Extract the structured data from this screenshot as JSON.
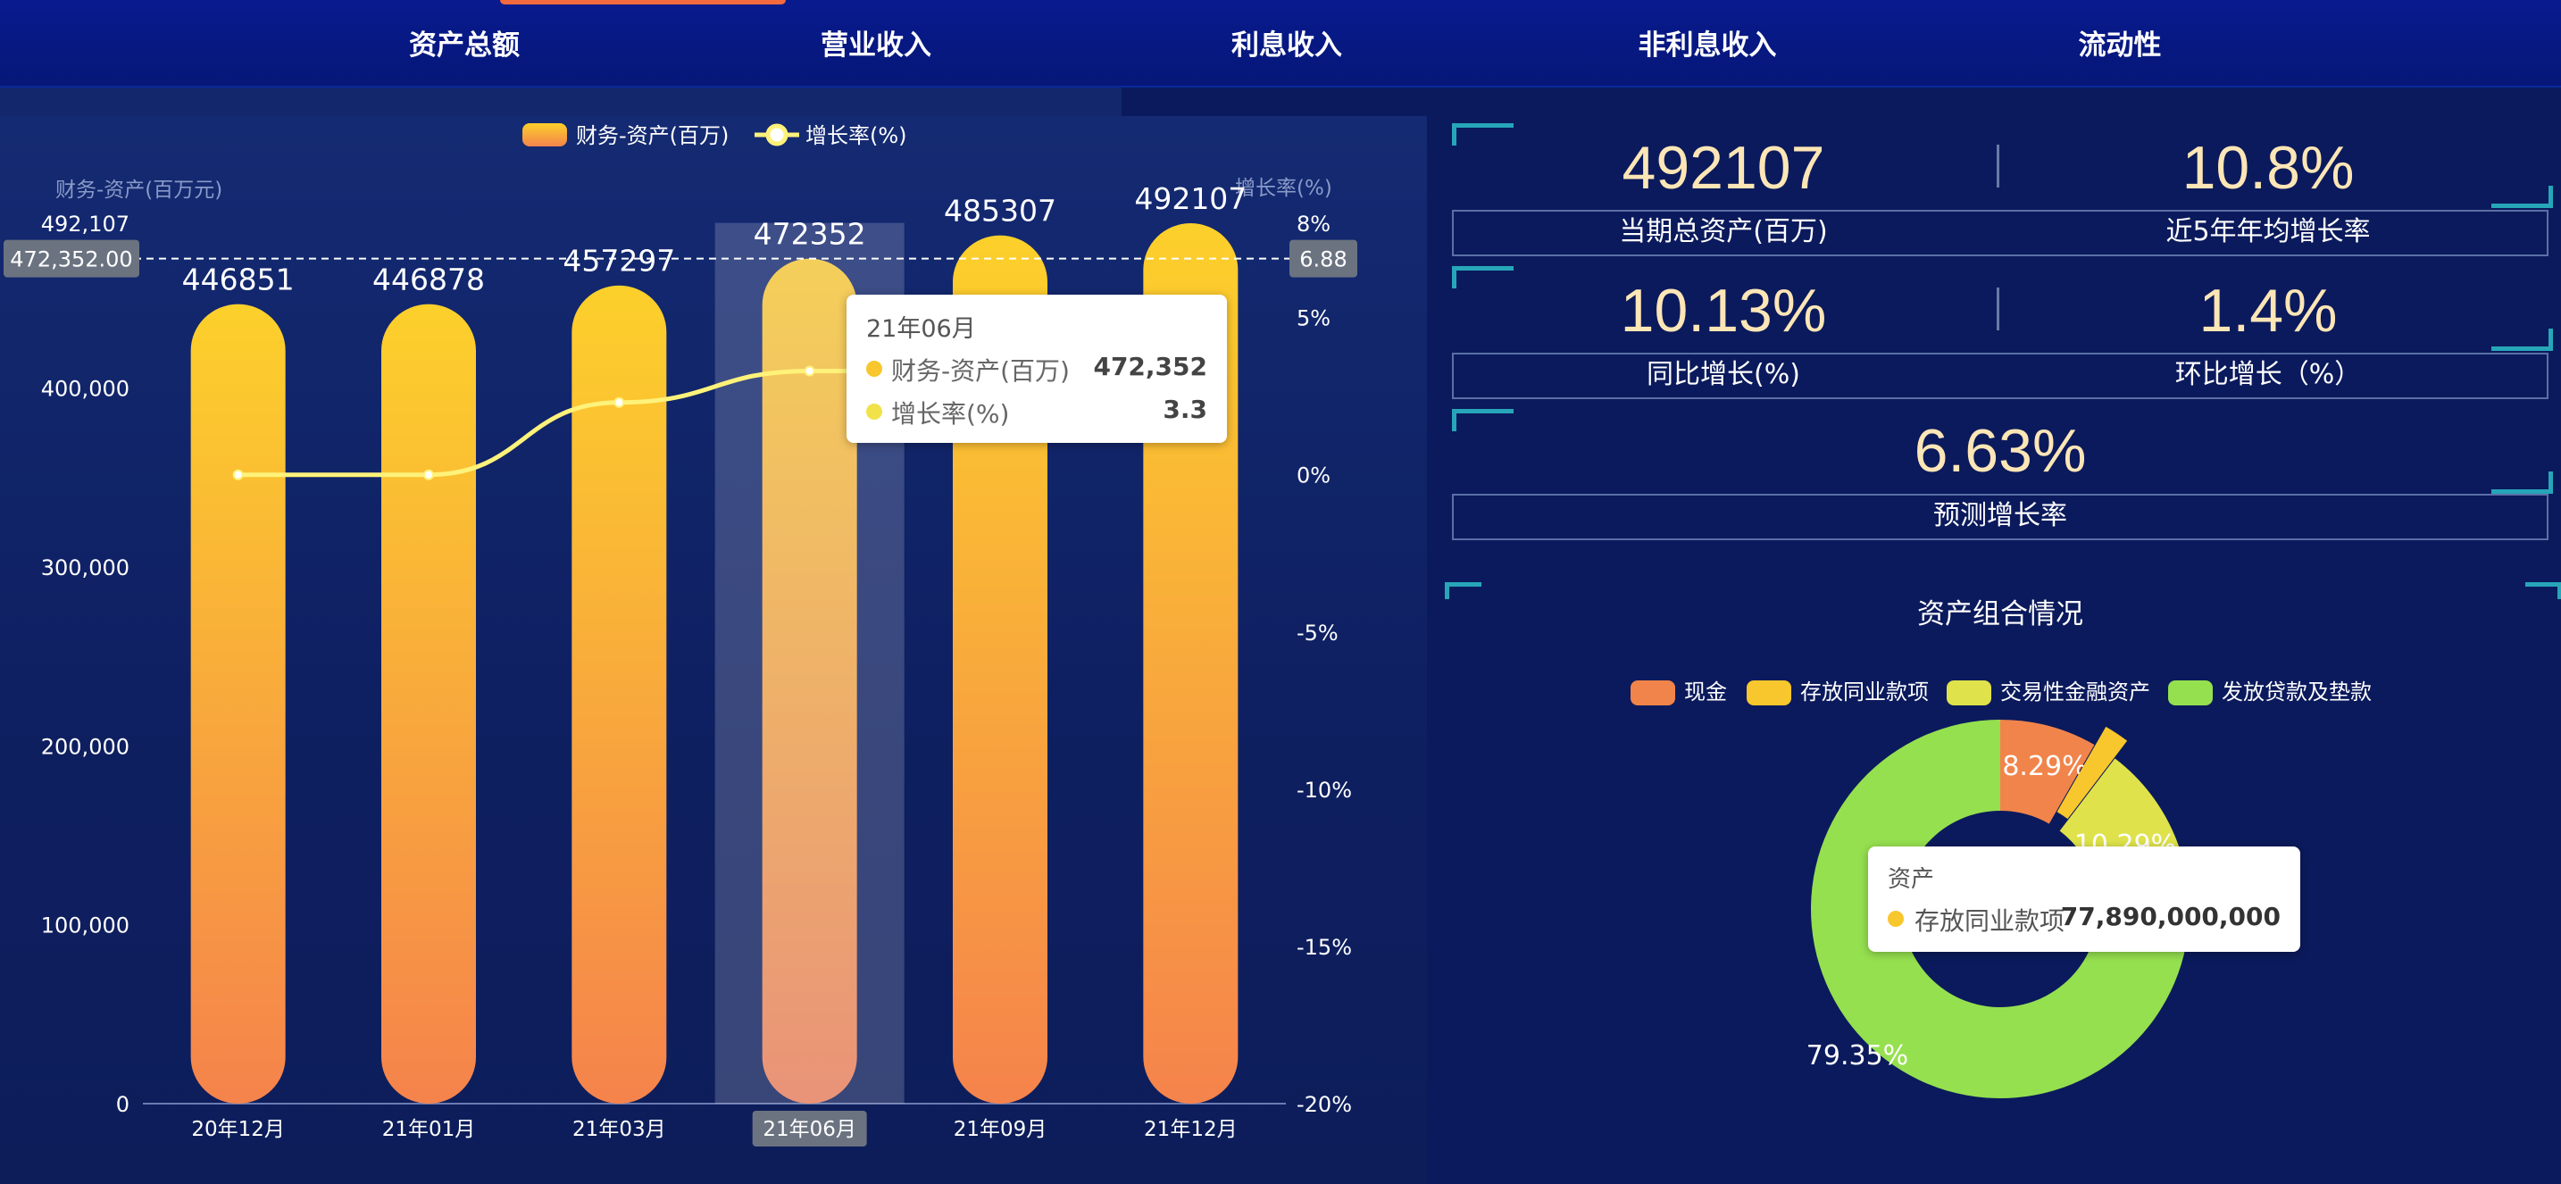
{
  "nav": {
    "tabs": [
      {
        "label": "资产总额"
      },
      {
        "label": "营业收入"
      },
      {
        "label": "利息收入"
      },
      {
        "label": "非利息收入"
      },
      {
        "label": "流动性"
      }
    ]
  },
  "chart_data": [
    {
      "type": "bar",
      "legend": [
        "财务-资产(百万)",
        "增长率(%)"
      ],
      "ylabel_left": "财务-资产(百万元)",
      "ylabel_right": "增长率(%)",
      "categories": [
        "20年12月",
        "21年01月",
        "21年03月",
        "21年06月",
        "21年09月",
        "21年12月"
      ],
      "series": [
        {
          "name": "财务-资产(百万)",
          "type": "bar",
          "values": [
            446851,
            446878,
            457297,
            472352,
            485307,
            492107
          ]
        },
        {
          "name": "增长率(%)",
          "type": "line",
          "values": [
            0,
            0,
            2.3,
            3.3,
            3.3,
            3.3
          ]
        }
      ],
      "y_left_ticks": [
        "0",
        "100,000",
        "200,000",
        "300,000",
        "400,000",
        "492,107"
      ],
      "y_left_range": [
        0,
        492107
      ],
      "y_right_ticks": [
        "8%",
        "5%",
        "0%",
        "-5%",
        "-10%",
        "-15%",
        "-20%"
      ],
      "y_right_range": [
        -20,
        8
      ],
      "crosshair": {
        "left_label": "472,352.00",
        "right_label": "6.88"
      },
      "highlight_category": "21年06月",
      "tooltip": {
        "title": "21年06月",
        "rows": [
          {
            "name": "财务-资产(百万)",
            "value": "472,352"
          },
          {
            "name": "增长率(%)",
            "value": "3.3"
          }
        ]
      },
      "colors": {
        "bar_top": "#fcd02b",
        "bar_bottom": "#f5834c",
        "line": "#fff27a"
      }
    },
    {
      "type": "pie",
      "title": "资产组合情况",
      "legend": [
        "现金",
        "存放同业款项",
        "交易性金融资产",
        "发放贷款及垫款"
      ],
      "values": [
        8.29,
        2.07,
        10.29,
        79.35
      ],
      "labels": [
        "8.29%",
        "",
        "10.29%",
        "79.35%"
      ],
      "colors": [
        "#f1844a",
        "#f8c62d",
        "#dfe24a",
        "#95e04f"
      ],
      "tooltip": {
        "title": "资产",
        "name": "存放同业款项",
        "value": "77,890,000,000"
      }
    }
  ],
  "kpis": [
    {
      "value": "492107",
      "label": "当期总资产(百万)"
    },
    {
      "value": "10.8%",
      "label": "近5年年均增长率"
    },
    {
      "value": "10.13%",
      "label": "同比增长(%)"
    },
    {
      "value": "1.4%",
      "label": "环比增长（%）"
    },
    {
      "value": "6.63%",
      "label": "预测增长率"
    }
  ]
}
